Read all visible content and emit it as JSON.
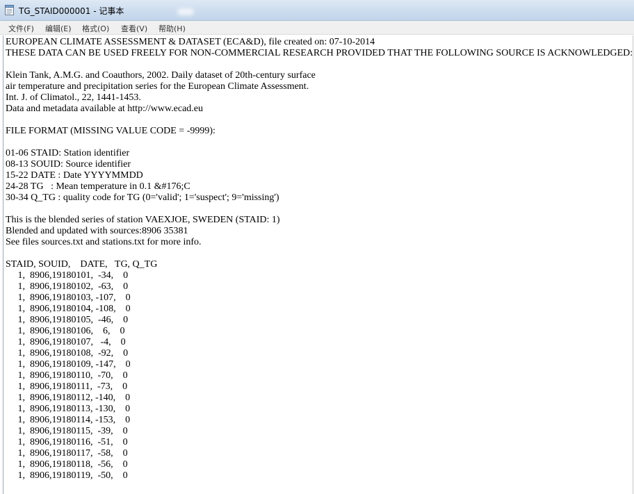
{
  "window": {
    "title": "TG_STAID000001 - 记事本"
  },
  "menu": {
    "file": "文件(F)",
    "edit": "编辑(E)",
    "format": "格式(O)",
    "view": "查看(V)",
    "help": "帮助(H)"
  },
  "document": {
    "lines": [
      "EUROPEAN CLIMATE ASSESSMENT & DATASET (ECA&D), file created on: 07-10-2014",
      "THESE DATA CAN BE USED FREELY FOR NON-COMMERCIAL RESEARCH PROVIDED THAT THE FOLLOWING SOURCE IS ACKNOWLEDGED:",
      "",
      "Klein Tank, A.M.G. and Coauthors, 2002. Daily dataset of 20th-century surface",
      "air temperature and precipitation series for the European Climate Assessment.",
      "Int. J. of Climatol., 22, 1441-1453.",
      "Data and metadata available at http://www.ecad.eu",
      "",
      "FILE FORMAT (MISSING VALUE CODE = -9999):",
      "",
      "01-06 STAID: Station identifier",
      "08-13 SOUID: Source identifier",
      "15-22 DATE : Date YYYYMMDD",
      "24-28 TG   : Mean temperature in 0.1 &#176;C",
      "30-34 Q_TG : quality code for TG (0='valid'; 1='suspect'; 9='missing')",
      "",
      "This is the blended series of station VAEXJOE, SWEDEN (STAID: 1)",
      "Blended and updated with sources:8906 35381",
      "See files sources.txt and stations.txt for more info.",
      "",
      "STAID, SOUID,    DATE,   TG, Q_TG",
      "     1,  8906,19180101,  -34,    0",
      "     1,  8906,19180102,  -63,    0",
      "     1,  8906,19180103, -107,    0",
      "     1,  8906,19180104, -108,    0",
      "     1,  8906,19180105,  -46,    0",
      "     1,  8906,19180106,    6,    0",
      "     1,  8906,19180107,   -4,    0",
      "     1,  8906,19180108,  -92,    0",
      "     1,  8906,19180109, -147,    0",
      "     1,  8906,19180110,  -70,    0",
      "     1,  8906,19180111,  -73,    0",
      "     1,  8906,19180112, -140,    0",
      "     1,  8906,19180113, -130,    0",
      "     1,  8906,19180114, -153,    0",
      "     1,  8906,19180115,  -39,    0",
      "     1,  8906,19180116,  -51,    0",
      "     1,  8906,19180117,  -58,    0",
      "     1,  8906,19180118,  -56,    0",
      "     1,  8906,19180119,  -50,    0"
    ]
  },
  "icons": {
    "app": "notepad-icon"
  }
}
